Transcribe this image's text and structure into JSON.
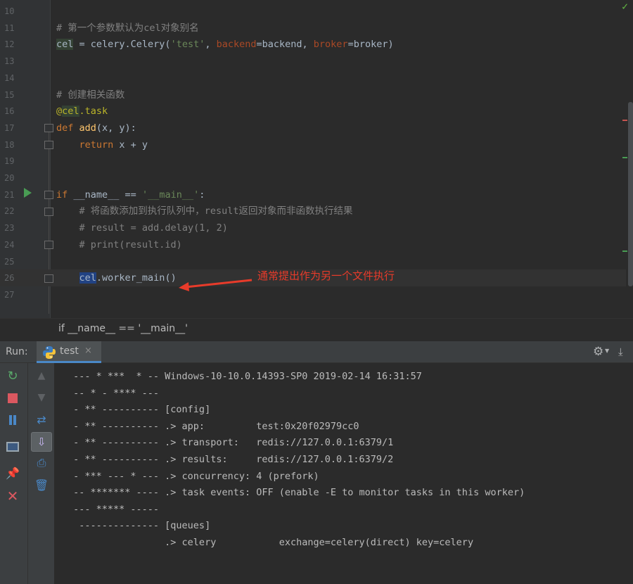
{
  "editor": {
    "lines": [
      {
        "n": "10",
        "parts": []
      },
      {
        "n": "11",
        "parts": [
          {
            "t": "# 第一个参数默认为cel对象别名",
            "c": "cm"
          }
        ]
      },
      {
        "n": "12",
        "parts": [
          {
            "t": "cel",
            "c": "hl1"
          },
          {
            "t": " = celery.Celery("
          },
          {
            "t": "'test'",
            "c": "st"
          },
          {
            "t": ", "
          },
          {
            "t": "backend",
            "c": "pk"
          },
          {
            "t": "=backend, "
          },
          {
            "t": "broker",
            "c": "pk"
          },
          {
            "t": "=broker)"
          }
        ]
      },
      {
        "n": "13",
        "parts": []
      },
      {
        "n": "14",
        "parts": []
      },
      {
        "n": "15",
        "parts": [
          {
            "t": "# 创建相关函数",
            "c": "cm"
          }
        ]
      },
      {
        "n": "16",
        "parts": [
          {
            "t": "@",
            "c": "dc"
          },
          {
            "t": "cel",
            "c": "dc hl1"
          },
          {
            "t": ".task",
            "c": "dc"
          }
        ]
      },
      {
        "n": "17",
        "parts": [
          {
            "t": "def ",
            "c": "kw"
          },
          {
            "t": "add",
            "c": "fn"
          },
          {
            "t": "(x, y):"
          }
        ]
      },
      {
        "n": "18",
        "parts": [
          {
            "t": "    "
          },
          {
            "t": "return",
            "c": "kw"
          },
          {
            "t": " x + y"
          }
        ]
      },
      {
        "n": "19",
        "parts": []
      },
      {
        "n": "20",
        "parts": []
      },
      {
        "n": "21",
        "parts": [
          {
            "t": "if",
            "c": "kw"
          },
          {
            "t": " __name__ == "
          },
          {
            "t": "'__main__'",
            "c": "st"
          },
          {
            "t": ":"
          }
        ]
      },
      {
        "n": "22",
        "parts": [
          {
            "t": "    "
          },
          {
            "t": "# 将函数添加到执行队列中，result返回对象而非函数执行结果",
            "c": "cm"
          }
        ]
      },
      {
        "n": "23",
        "parts": [
          {
            "t": "    "
          },
          {
            "t": "# result = add.delay(1, 2)",
            "c": "cm"
          }
        ]
      },
      {
        "n": "24",
        "parts": [
          {
            "t": "    "
          },
          {
            "t": "# print(result.id)",
            "c": "cm"
          }
        ]
      },
      {
        "n": "25",
        "parts": []
      },
      {
        "n": "26",
        "parts": [
          {
            "t": "    "
          },
          {
            "t": "cel",
            "c": "hl2"
          },
          {
            "t": ".worker_main()"
          }
        ]
      },
      {
        "n": "27",
        "parts": []
      }
    ],
    "annotation": "通常提出作为另一个文件执行",
    "annotation_color": "#e83b2a"
  },
  "breadcrumb": "if __name__ == '__main__'",
  "run": {
    "label": "Run:",
    "tab_label": "test",
    "tab_close": "×",
    "accent": "#4a88c7"
  },
  "console": [
    " --- * ***  * -- Windows-10-10.0.14393-SP0 2019-02-14 16:31:57",
    " -- * - **** ---",
    " - ** ---------- [config]",
    " - ** ---------- .> app:         test:0x20f02979cc0",
    " - ** ---------- .> transport:   redis://127.0.0.1:6379/1",
    " - ** ---------- .> results:     redis://127.0.0.1:6379/2",
    " - *** --- * --- .> concurrency: 4 (prefork)",
    " -- ******* ---- .> task events: OFF (enable -E to monitor tasks in this worker)",
    " --- ***** -----",
    "  -------------- [queues]",
    "                 .> celery           exchange=celery(direct) key=celery"
  ]
}
